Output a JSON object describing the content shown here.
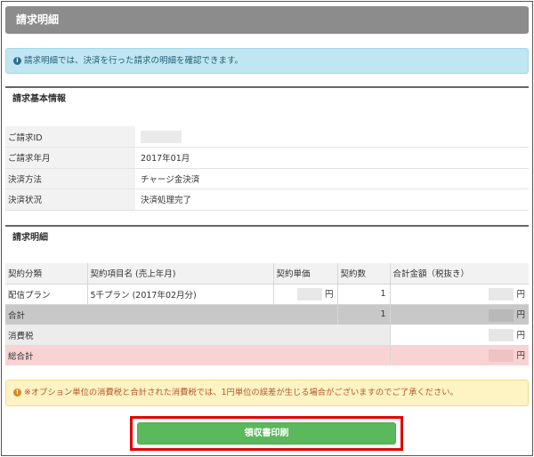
{
  "title": "請求明細",
  "info_text": "請求明細では、決済を行った請求の明細を確認できます。",
  "basic": {
    "heading": "請求基本情報",
    "rows": [
      {
        "label": "ご請求ID",
        "value": ""
      },
      {
        "label": "ご請求年月",
        "value": "2017年01月"
      },
      {
        "label": "決済方法",
        "value": "チャージ金決済"
      },
      {
        "label": "決済状況",
        "value": "決済処理完了"
      }
    ]
  },
  "detail": {
    "heading": "請求明細",
    "headers": [
      "契約分類",
      "契約項目名 (売上年月)",
      "契約単価",
      "契約数",
      "合計金額（税抜き）"
    ],
    "row": {
      "category": "配信プラン",
      "item": "5千プラン (2017年02月分)",
      "unit_yen": "円",
      "qty": "1",
      "total_yen": "円"
    },
    "subtotal": {
      "label": "合計",
      "qty": "1",
      "yen": "円"
    },
    "tax": {
      "label": "消費税",
      "yen": "円"
    },
    "grand_total": {
      "label": "総合計",
      "yen": "円"
    }
  },
  "warning_text": "※オプション単位の消費税と合計された消費税では、1円単位の誤差が生じる場合がございますのでご了承ください。",
  "print_button": "領収書印刷"
}
